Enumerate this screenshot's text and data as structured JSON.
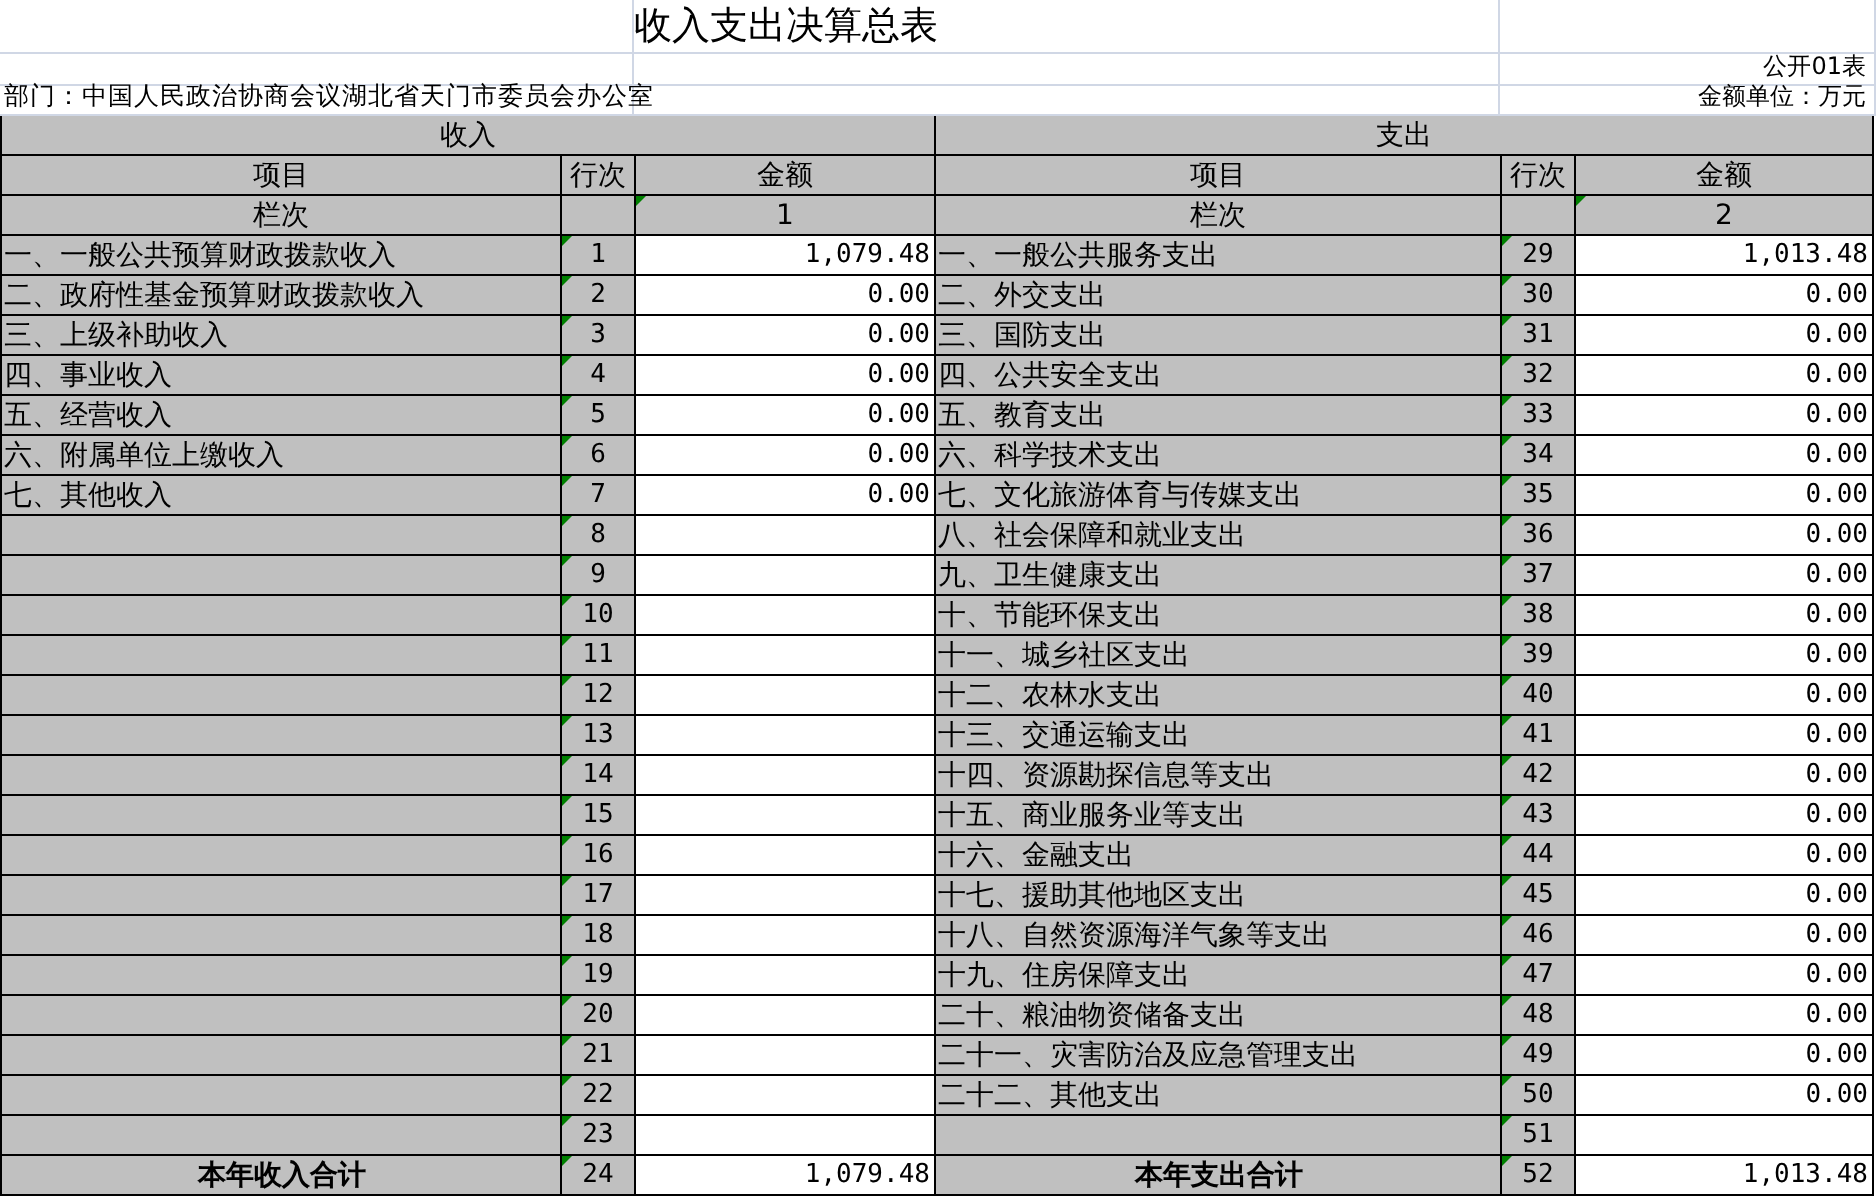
{
  "title": "收入支出决算总表",
  "form_no": "公开01表",
  "department": "部门：中国人民政治协商会议湖北省天门市委员会办公室",
  "unit": "金额单位：万元",
  "sections": [
    {
      "heading": "收入",
      "columns": [
        "项目",
        "行次",
        "金额"
      ],
      "index_label": "栏次",
      "index_no": "1"
    },
    {
      "heading": "支出",
      "columns": [
        "项目",
        "行次",
        "金额"
      ],
      "index_label": "栏次",
      "index_no": "2"
    }
  ],
  "rows": [
    {
      "kind": "item",
      "income": {
        "item": "一、一般公共预算财政拨款收入",
        "line": "1",
        "amount": "1,079.48"
      },
      "expense": {
        "item": "一、一般公共服务支出",
        "line": "29",
        "amount": "1,013.48"
      }
    },
    {
      "kind": "item",
      "income": {
        "item": "二、政府性基金预算财政拨款收入",
        "line": "2",
        "amount": "0.00"
      },
      "expense": {
        "item": "二、外交支出",
        "line": "30",
        "amount": "0.00"
      }
    },
    {
      "kind": "item",
      "income": {
        "item": "三、上级补助收入",
        "line": "3",
        "amount": "0.00"
      },
      "expense": {
        "item": "三、国防支出",
        "line": "31",
        "amount": "0.00"
      }
    },
    {
      "kind": "item",
      "income": {
        "item": "四、事业收入",
        "line": "4",
        "amount": "0.00"
      },
      "expense": {
        "item": "四、公共安全支出",
        "line": "32",
        "amount": "0.00"
      }
    },
    {
      "kind": "item",
      "income": {
        "item": "五、经营收入",
        "line": "5",
        "amount": "0.00"
      },
      "expense": {
        "item": "五、教育支出",
        "line": "33",
        "amount": "0.00"
      }
    },
    {
      "kind": "item",
      "income": {
        "item": "六、附属单位上缴收入",
        "line": "6",
        "amount": "0.00"
      },
      "expense": {
        "item": "六、科学技术支出",
        "line": "34",
        "amount": "0.00"
      }
    },
    {
      "kind": "item",
      "income": {
        "item": "七、其他收入",
        "line": "7",
        "amount": "0.00"
      },
      "expense": {
        "item": "七、文化旅游体育与传媒支出",
        "line": "35",
        "amount": "0.00"
      }
    },
    {
      "kind": "item",
      "income": {
        "line": "8"
      },
      "expense": {
        "item": "八、社会保障和就业支出",
        "line": "36",
        "amount": "0.00"
      }
    },
    {
      "kind": "item",
      "income": {
        "line": "9"
      },
      "expense": {
        "item": "九、卫生健康支出",
        "line": "37",
        "amount": "0.00"
      }
    },
    {
      "kind": "item",
      "income": {
        "line": "10"
      },
      "expense": {
        "item": "十、节能环保支出",
        "line": "38",
        "amount": "0.00"
      }
    },
    {
      "kind": "item",
      "income": {
        "line": "11"
      },
      "expense": {
        "item": "十一、城乡社区支出",
        "line": "39",
        "amount": "0.00"
      }
    },
    {
      "kind": "item",
      "income": {
        "line": "12"
      },
      "expense": {
        "item": "十二、农林水支出",
        "line": "40",
        "amount": "0.00"
      }
    },
    {
      "kind": "item",
      "income": {
        "line": "13"
      },
      "expense": {
        "item": "十三、交通运输支出",
        "line": "41",
        "amount": "0.00"
      }
    },
    {
      "kind": "item",
      "income": {
        "line": "14"
      },
      "expense": {
        "item": "十四、资源勘探信息等支出",
        "line": "42",
        "amount": "0.00"
      }
    },
    {
      "kind": "item",
      "income": {
        "line": "15"
      },
      "expense": {
        "item": "十五、商业服务业等支出",
        "line": "43",
        "amount": "0.00"
      }
    },
    {
      "kind": "item",
      "income": {
        "line": "16"
      },
      "expense": {
        "item": "十六、金融支出",
        "line": "44",
        "amount": "0.00"
      }
    },
    {
      "kind": "item",
      "income": {
        "line": "17"
      },
      "expense": {
        "item": "十七、援助其他地区支出",
        "line": "45",
        "amount": "0.00"
      }
    },
    {
      "kind": "item",
      "income": {
        "line": "18"
      },
      "expense": {
        "item": "十八、自然资源海洋气象等支出",
        "line": "46",
        "amount": "0.00"
      }
    },
    {
      "kind": "item",
      "income": {
        "line": "19"
      },
      "expense": {
        "item": "十九、住房保障支出",
        "line": "47",
        "amount": "0.00"
      }
    },
    {
      "kind": "item",
      "income": {
        "line": "20"
      },
      "expense": {
        "item": "二十、粮油物资储备支出",
        "line": "48",
        "amount": "0.00"
      }
    },
    {
      "kind": "item",
      "income": {
        "line": "21"
      },
      "expense": {
        "item": "二十一、灾害防治及应急管理支出",
        "line": "49",
        "amount": "0.00"
      }
    },
    {
      "kind": "item",
      "income": {
        "line": "22"
      },
      "expense": {
        "item": "二十二、其他支出",
        "line": "50",
        "amount": "0.00"
      }
    },
    {
      "kind": "item",
      "income": {
        "line": "23"
      },
      "expense": {
        "line": "51"
      }
    },
    {
      "kind": "total",
      "income": {
        "item": "本年收入合计",
        "line": "24",
        "amount": "1,079.48"
      },
      "expense": {
        "item": "本年支出合计",
        "line": "52",
        "amount": "1,013.48"
      }
    }
  ]
}
